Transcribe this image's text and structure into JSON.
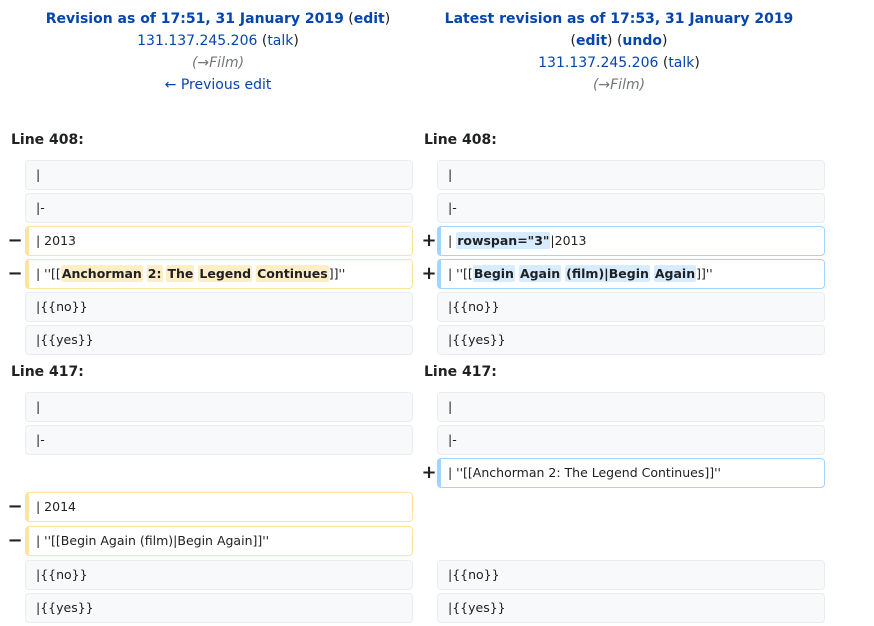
{
  "left_header": {
    "title": "Revision as of 17:51, 31 January 2019",
    "edit_label": "edit",
    "user": "131.137.245.206",
    "talk_label": "talk",
    "summary": "(→Film)",
    "prev_edit": "← Previous edit"
  },
  "right_header": {
    "title": "Latest revision as of 17:53, 31 January 2019",
    "edit_label": "edit",
    "undo_label": "undo",
    "user": "131.137.245.206",
    "talk_label": "talk",
    "summary": "(→Film)"
  },
  "blocks": [
    {
      "line_left": "Line 408:",
      "line_right": "Line 408:",
      "ctx_top": [
        "|",
        "|-"
      ],
      "del": [
        {
          "plain": "| 2013"
        },
        {
          "pre": "| ''[[",
          "parts": [
            "Anchorman",
            "2:",
            "The",
            "Legend",
            "Continues"
          ],
          "post": "]]''"
        }
      ],
      "add": [
        {
          "pre": "| ",
          "hl": "rowspan=\"3\"",
          "post": "|2013"
        },
        {
          "pre": "| ''[[",
          "parts": [
            "Begin",
            "Again",
            "(film)|Begin",
            "Again"
          ],
          "post": "]]''"
        }
      ],
      "ctx_bottom": [
        "|{{no}}",
        "|{{yes}}"
      ]
    },
    {
      "line_left": "Line 417:",
      "line_right": "Line 417:",
      "ctx_top": [
        "|",
        "|-"
      ],
      "add_only": "| ''[[Anchorman 2: The Legend Continues]]''",
      "del_only": [
        "| 2014",
        "| ''[[Begin Again (film)|Begin Again]]''"
      ],
      "ctx_bottom": [
        "|{{no}}",
        "|{{yes}}"
      ]
    }
  ],
  "markers": {
    "minus": "−",
    "plus": "+"
  },
  "colors": {
    "del_border": "#ffe49c",
    "add_border": "#a3d3ff",
    "link": "#0645ad",
    "context_bg": "#f8f9fa"
  }
}
